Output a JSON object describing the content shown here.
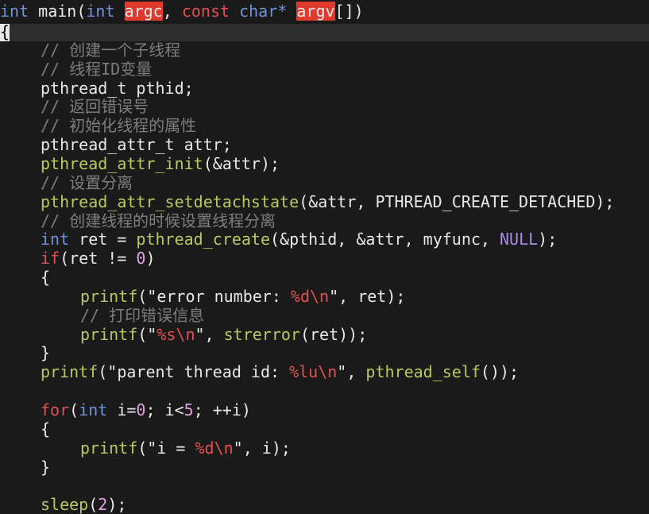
{
  "editor": {
    "signature": {
      "type": "int",
      "name": "main",
      "open": "(",
      "arg1_type": "int",
      "arg1_name": "argc",
      "sep": ",",
      "arg2_kw": "const",
      "arg2_type": "char*",
      "arg2_name": "argv",
      "close": "[])"
    },
    "open_brace": "{",
    "lines": {
      "c1": "// 创建一个子线程",
      "c2": "// 线程ID变量",
      "l3": "pthread_t pthid;",
      "c4": "// 返回错误号",
      "c5": "// 初始化线程的属性",
      "l6": "pthread_attr_t attr;",
      "l7_fn": "pthread_attr_init",
      "l7_rest": "(&attr);",
      "c8": "// 设置分离",
      "l9_fn": "pthread_attr_setdetachstate",
      "l9_rest": "(&attr, PTHREAD_CREATE_DETACHED);",
      "c10": "// 创建线程的时候设置线程分离",
      "l11_type": "int",
      "l11_a": " ret = ",
      "l11_fn": "pthread_create",
      "l11_b": "(&pthid, &attr, myfunc, ",
      "l11_null": "NULL",
      "l11_c": ");",
      "l12_kw": "if",
      "l12_a": "(ret != ",
      "l12_num": "0",
      "l12_b": ")",
      "l13": "{",
      "l14_fn": "printf",
      "l14_a": "(\"error number: ",
      "l14_fmt1": "%d\\n",
      "l14_b": "\", ret);",
      "c15": "// 打印错误信息",
      "l16_fn": "printf",
      "l16_a": "(\"",
      "l16_fmt": "%s\\n",
      "l16_b": "\", ",
      "l16_fn2": "strerror",
      "l16_c": "(ret));",
      "l17": "}",
      "l18_fn": "printf",
      "l18_a": "(\"parent thread id: ",
      "l18_fmt": "%lu\\n",
      "l18_b": "\", ",
      "l18_fn2": "pthread_self",
      "l18_c": "());",
      "l20_kw": "for",
      "l20_a": "(",
      "l20_type": "int",
      "l20_b": " i=",
      "l20_n0": "0",
      "l20_c": "; i<",
      "l20_n5": "5",
      "l20_d": "; ++i)",
      "l21": "{",
      "l22_fn": "printf",
      "l22_a": "(\"i = ",
      "l22_fmt": "%d\\n",
      "l22_b": "\", i);",
      "l23": "}",
      "l25_fn": "sleep",
      "l25_a": "(",
      "l25_num": "2",
      "l25_b": ");"
    }
  }
}
